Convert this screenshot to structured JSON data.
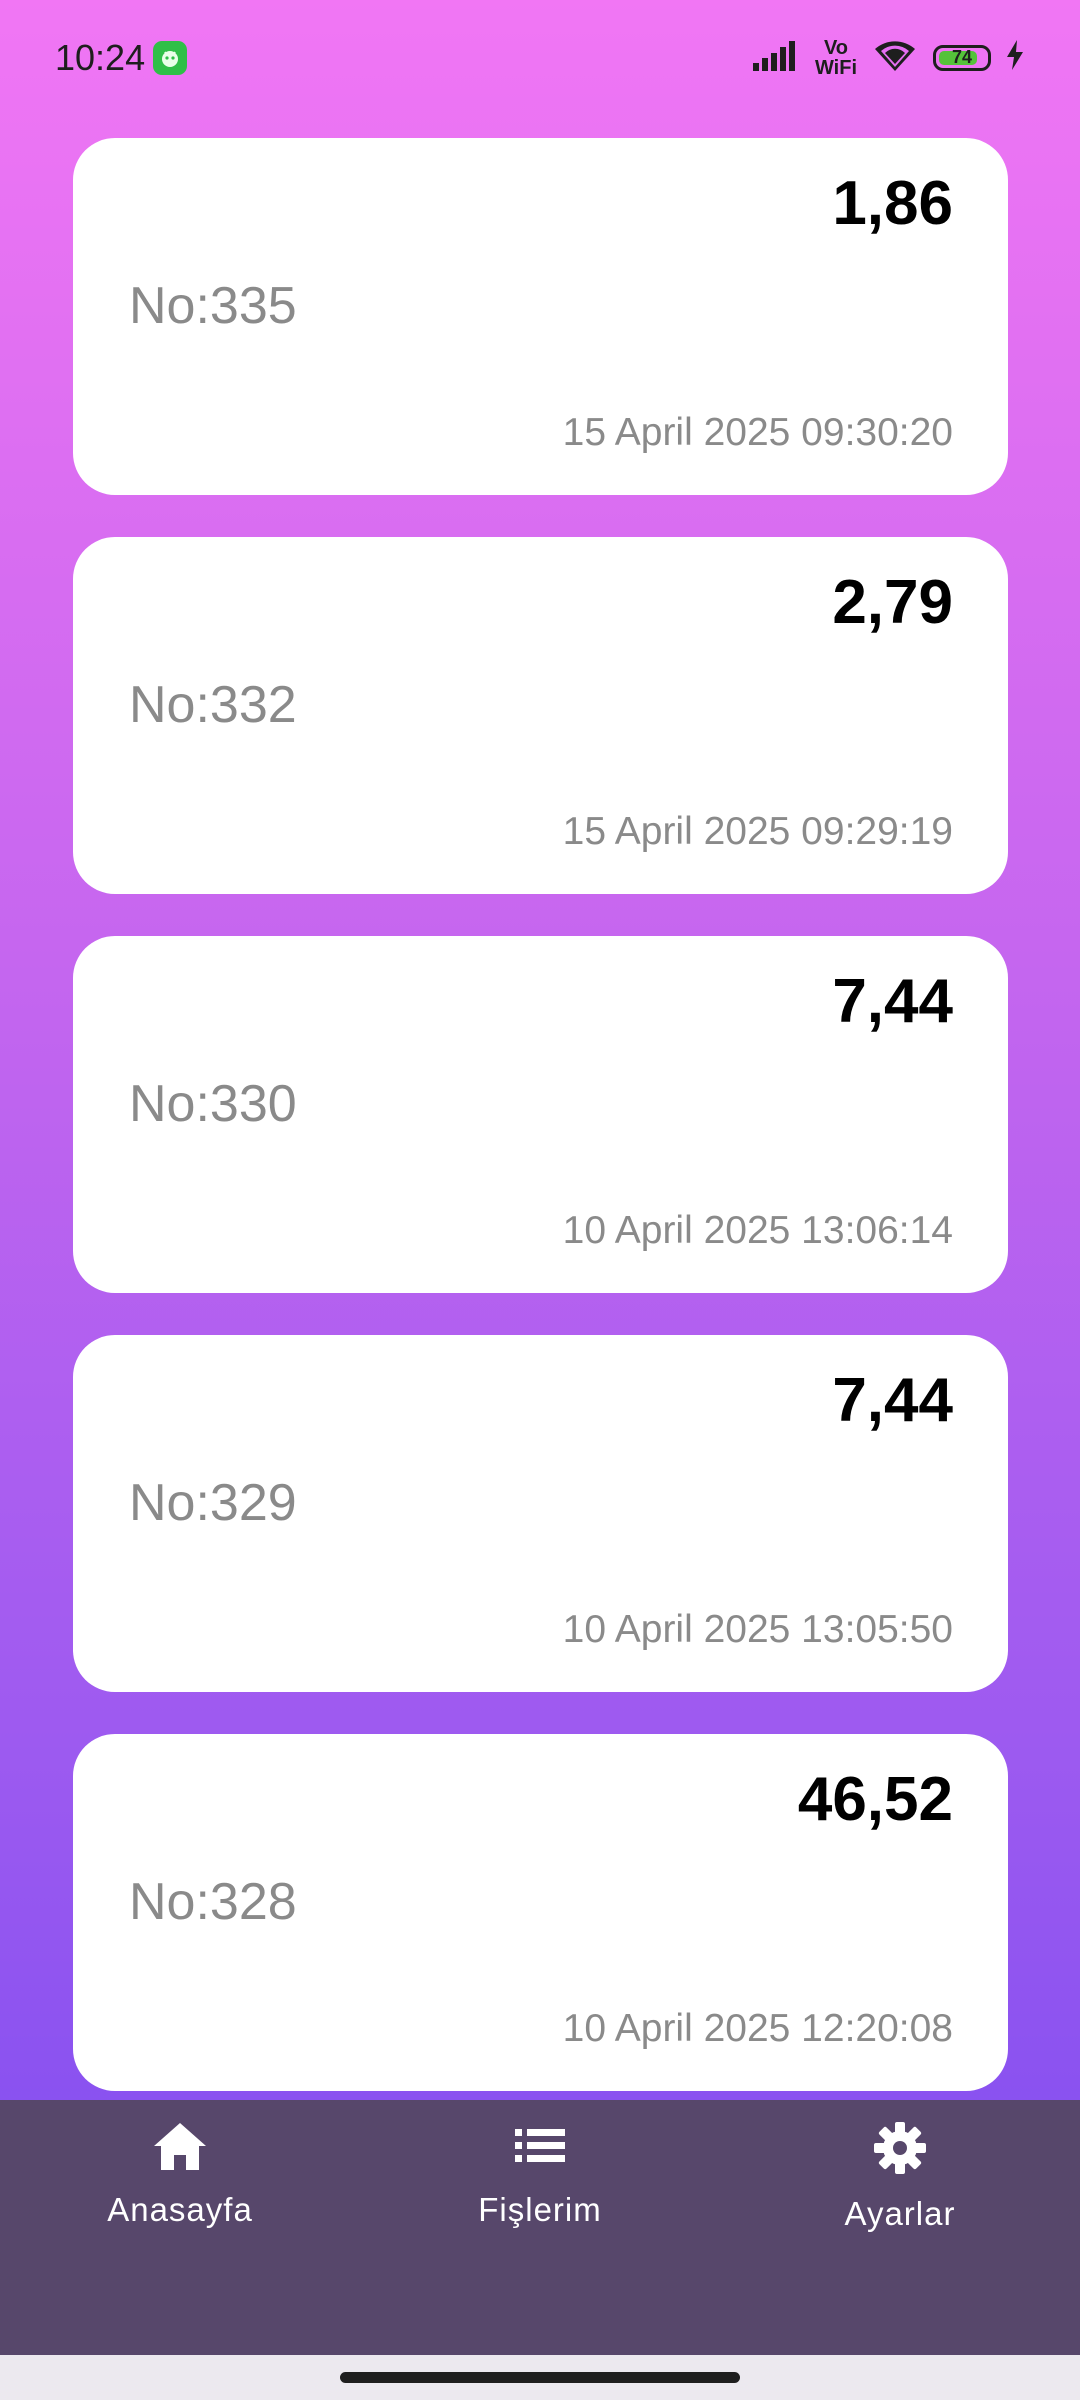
{
  "status_bar": {
    "time": "10:24",
    "battery_level": "74",
    "network_label_top": "Vo",
    "network_label_bottom": "WiFi"
  },
  "receipts": [
    {
      "amount": "1,86",
      "number": "No:335",
      "date": "15 April 2025 09:30:20"
    },
    {
      "amount": "2,79",
      "number": "No:332",
      "date": "15 April 2025 09:29:19"
    },
    {
      "amount": "7,44",
      "number": "No:330",
      "date": "10 April 2025 13:06:14"
    },
    {
      "amount": "7,44",
      "number": "No:329",
      "date": "10 April 2025 13:05:50"
    },
    {
      "amount": "46,52",
      "number": "No:328",
      "date": "10 April 2025 12:20:08"
    }
  ],
  "bottom_nav": {
    "home_label": "Anasayfa",
    "receipts_label": "Fişlerim",
    "settings_label": "Ayarlar"
  },
  "colors": {
    "gradient_top": "#f176f4",
    "gradient_bottom": "#7a4bf0",
    "nav_background": "#57476b",
    "card_background": "#ffffff",
    "secondary_text": "#8a8a8a"
  },
  "icons": {
    "home": "home-icon",
    "receipts": "list-icon",
    "settings": "gear-icon"
  }
}
